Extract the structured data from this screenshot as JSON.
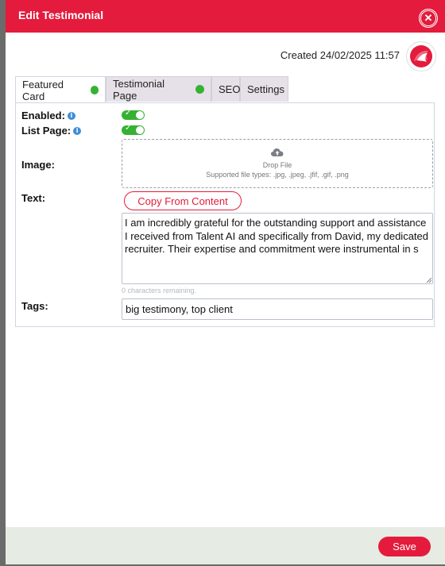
{
  "header": {
    "title": "Edit Testimonial"
  },
  "meta": {
    "created": "Created 24/02/2025 11:57"
  },
  "tabs": [
    {
      "label": "Featured Card",
      "status": "complete"
    },
    {
      "label": "Testimonial Page",
      "status": "complete"
    },
    {
      "label": "SEO"
    },
    {
      "label": "Settings"
    }
  ],
  "form": {
    "enabled_label": "Enabled:",
    "enabled_value": true,
    "list_page_label": "List Page:",
    "list_page_value": true,
    "image_label": "Image:",
    "drop_title": "Drop File",
    "drop_types": "Supported file types: .jpg, .jpeg, .jfif, .gif, .png",
    "text_label": "Text:",
    "copy_button": "Copy From Content",
    "text_value": "I am incredibly grateful for the outstanding support and assistance I received from Talent AI and specifically from David, my dedicated recruiter. Their expertise and commitment were instrumental in s",
    "remaining": "0 characters remaining.",
    "tags_label": "Tags:",
    "tags_value": "big testimony, top client"
  },
  "footer": {
    "save_label": "Save"
  },
  "colors": {
    "brand": "#e41b3c",
    "success": "#35b233",
    "info": "#3d8fd6"
  },
  "icons": {
    "close": "close-icon",
    "upload": "cloud-upload-icon",
    "info": "info-icon",
    "logo": "fish-logo"
  }
}
